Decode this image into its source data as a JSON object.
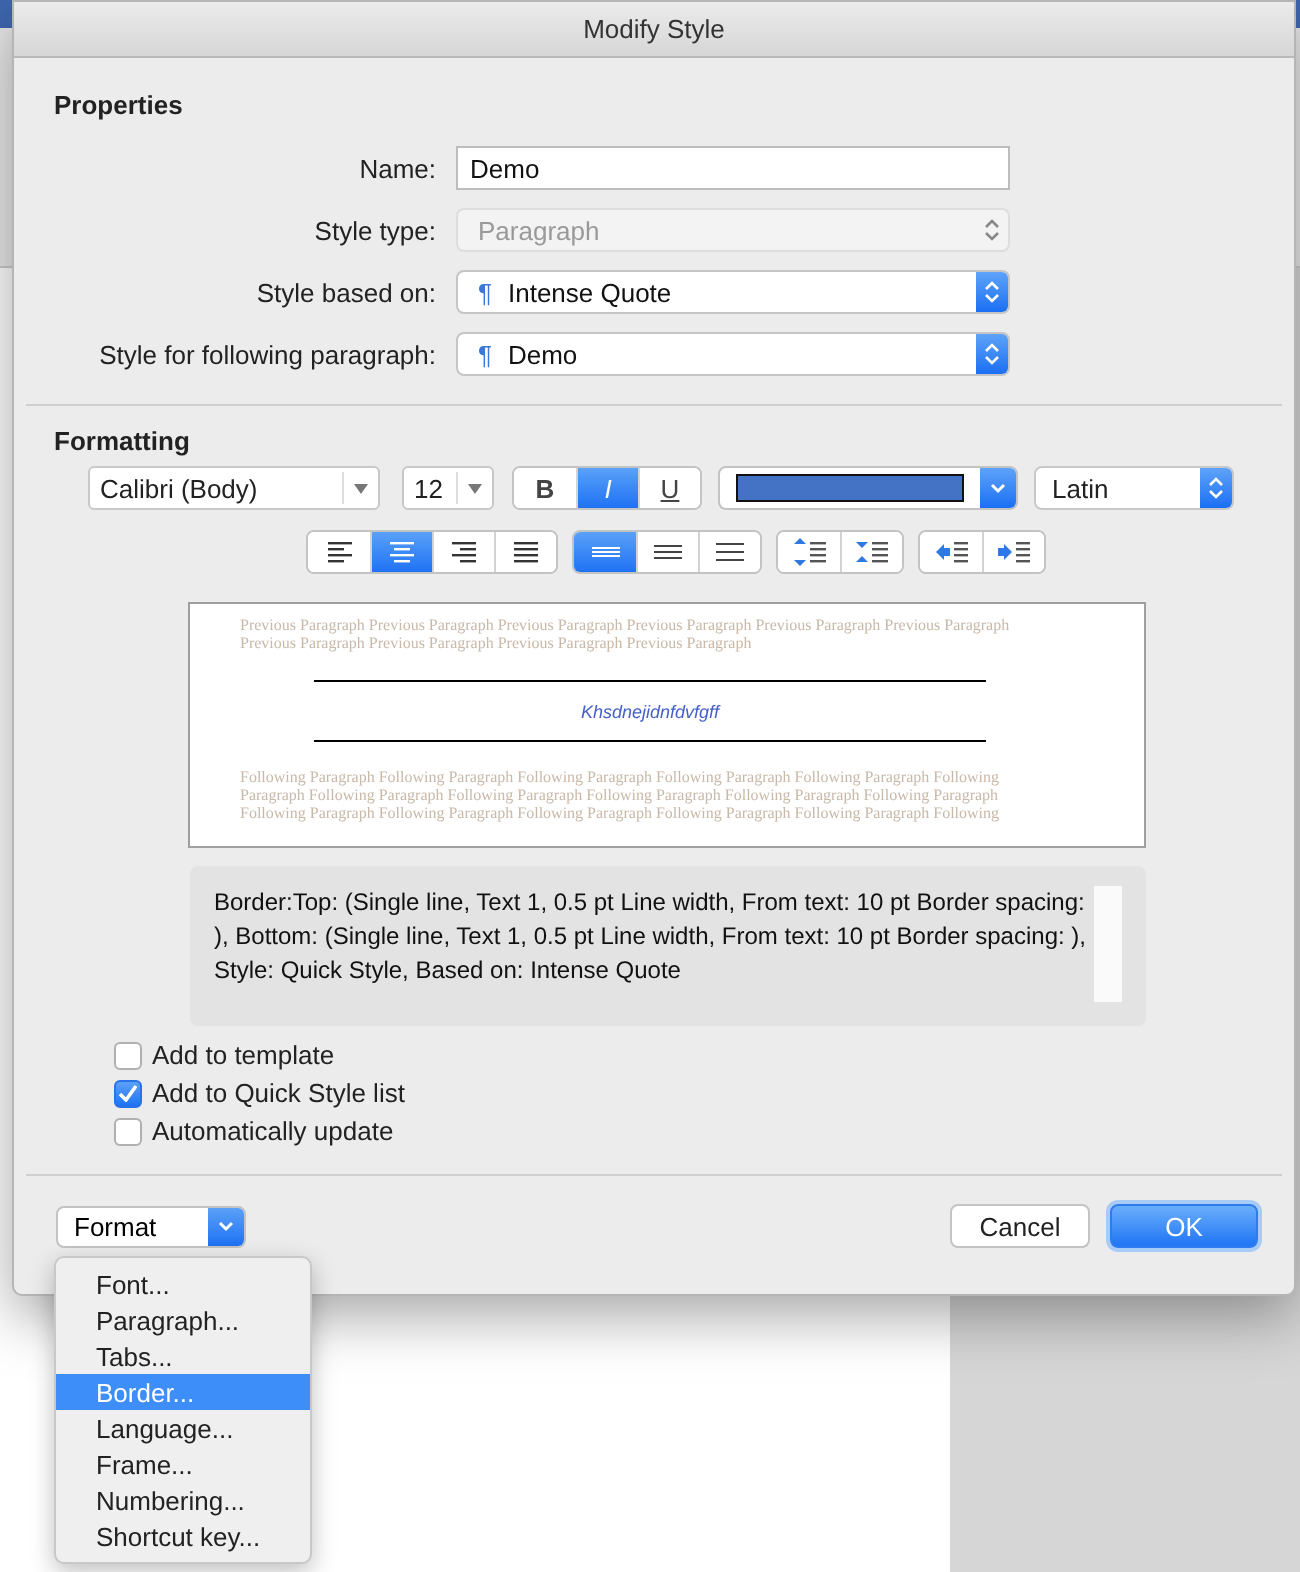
{
  "window": {
    "title": "Modify Style"
  },
  "properties": {
    "heading": "Properties",
    "fields": [
      {
        "kind": "text",
        "label": "Name:",
        "value": "Demo",
        "disabled": false
      },
      {
        "kind": "select",
        "label": "Style type:",
        "value": "Paragraph",
        "disabled": true
      },
      {
        "kind": "select",
        "label": "Style based on:",
        "value": "Intense Quote",
        "disabled": false,
        "marker": "¶"
      },
      {
        "kind": "select",
        "label": "Style for following paragraph:",
        "value": "Demo",
        "disabled": false,
        "marker": "¶"
      }
    ]
  },
  "formatting": {
    "heading": "Formatting",
    "font": "Calibri (Body)",
    "size": "12",
    "styles": [
      {
        "label": "B",
        "selected": false
      },
      {
        "label": "I",
        "selected": true
      },
      {
        "label": "U",
        "selected": false
      }
    ],
    "color": "#4472c4",
    "script": "Latin",
    "alignment": [
      {
        "kind": "left",
        "selected": false
      },
      {
        "kind": "center",
        "selected": true
      },
      {
        "kind": "right",
        "selected": false
      },
      {
        "kind": "justify",
        "selected": false
      }
    ],
    "line_spacing": [
      {
        "kind": "single",
        "selected": true
      },
      {
        "kind": "one-half",
        "selected": false
      },
      {
        "kind": "double",
        "selected": false
      }
    ],
    "paragraph_spacing": [
      {
        "kind": "increase"
      },
      {
        "kind": "decrease"
      }
    ],
    "indent": [
      {
        "kind": "decrease"
      },
      {
        "kind": "increase"
      }
    ]
  },
  "preview": {
    "previous": [
      "Previous Paragraph Previous Paragraph Previous Paragraph Previous Paragraph Previous Paragraph Previous Paragraph",
      "Previous Paragraph Previous Paragraph Previous Paragraph Previous Paragraph"
    ],
    "sample": "Khsdnejidnfdvfgff",
    "following": [
      "Following Paragraph Following Paragraph Following Paragraph Following Paragraph Following Paragraph Following",
      "Paragraph Following Paragraph Following Paragraph Following Paragraph Following Paragraph Following Paragraph",
      "Following Paragraph Following Paragraph Following Paragraph Following Paragraph Following Paragraph Following"
    ]
  },
  "description": "Border:Top: (Single line, Text 1,  0.5 pt Line width, From text:  10 pt Border spacing: ), Bottom: (Single line, Text 1,  0.5 pt Line width, From text:  10 pt Border spacing: ), Style: Quick Style, Based on: Intense Quote",
  "options": [
    {
      "label": "Add to template",
      "checked": false
    },
    {
      "label": "Add to Quick Style list",
      "checked": true
    },
    {
      "label": "Automatically update",
      "checked": false
    }
  ],
  "format_button": "Format",
  "buttons": [
    {
      "label": "Cancel",
      "kind": "secondary"
    },
    {
      "label": "OK",
      "kind": "default"
    }
  ],
  "format_menu": [
    {
      "label": "Font...",
      "selected": false
    },
    {
      "label": "Paragraph...",
      "selected": false
    },
    {
      "label": "Tabs...",
      "selected": false
    },
    {
      "label": "Border...",
      "selected": true
    },
    {
      "label": "Language...",
      "selected": false
    },
    {
      "label": "Frame...",
      "selected": false
    },
    {
      "label": "Numbering...",
      "selected": false
    },
    {
      "label": "Shortcut key...",
      "selected": false
    }
  ]
}
